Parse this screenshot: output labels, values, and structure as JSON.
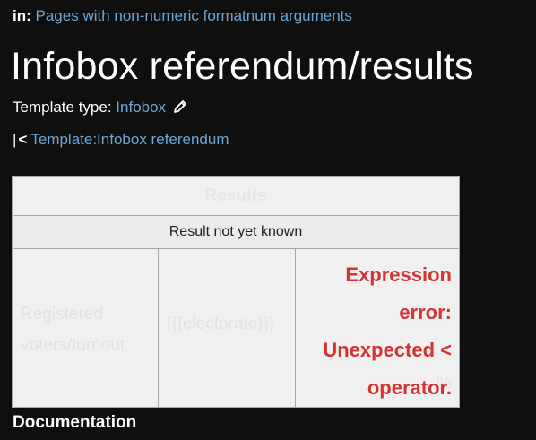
{
  "breadcrumb": {
    "prefix": "in:",
    "category": "Pages with non-numeric formatnum arguments"
  },
  "page": {
    "title": "Infobox referendum/results"
  },
  "template_type": {
    "label": "Template type:",
    "value": "Infobox",
    "icon": "edit-pencil-icon"
  },
  "parent": {
    "bar": "|",
    "arrow": "<",
    "link": "Template:Infobox referendum"
  },
  "infobox": {
    "caption": "Results",
    "status": "Result not yet known",
    "label_line1": "Registered",
    "label_line2": "voters/turnout",
    "electorate": "{{{electorate}}}",
    "error_lines": [
      "Expression",
      "error:",
      "Unexpected <",
      "operator."
    ],
    "percent": "%"
  },
  "documentation": {
    "heading": "Documentation"
  },
  "colors": {
    "background": "#0f0f10",
    "link": "#6ea5d6",
    "error": "#d33333",
    "infobox_bg": "#f0f0f0"
  }
}
